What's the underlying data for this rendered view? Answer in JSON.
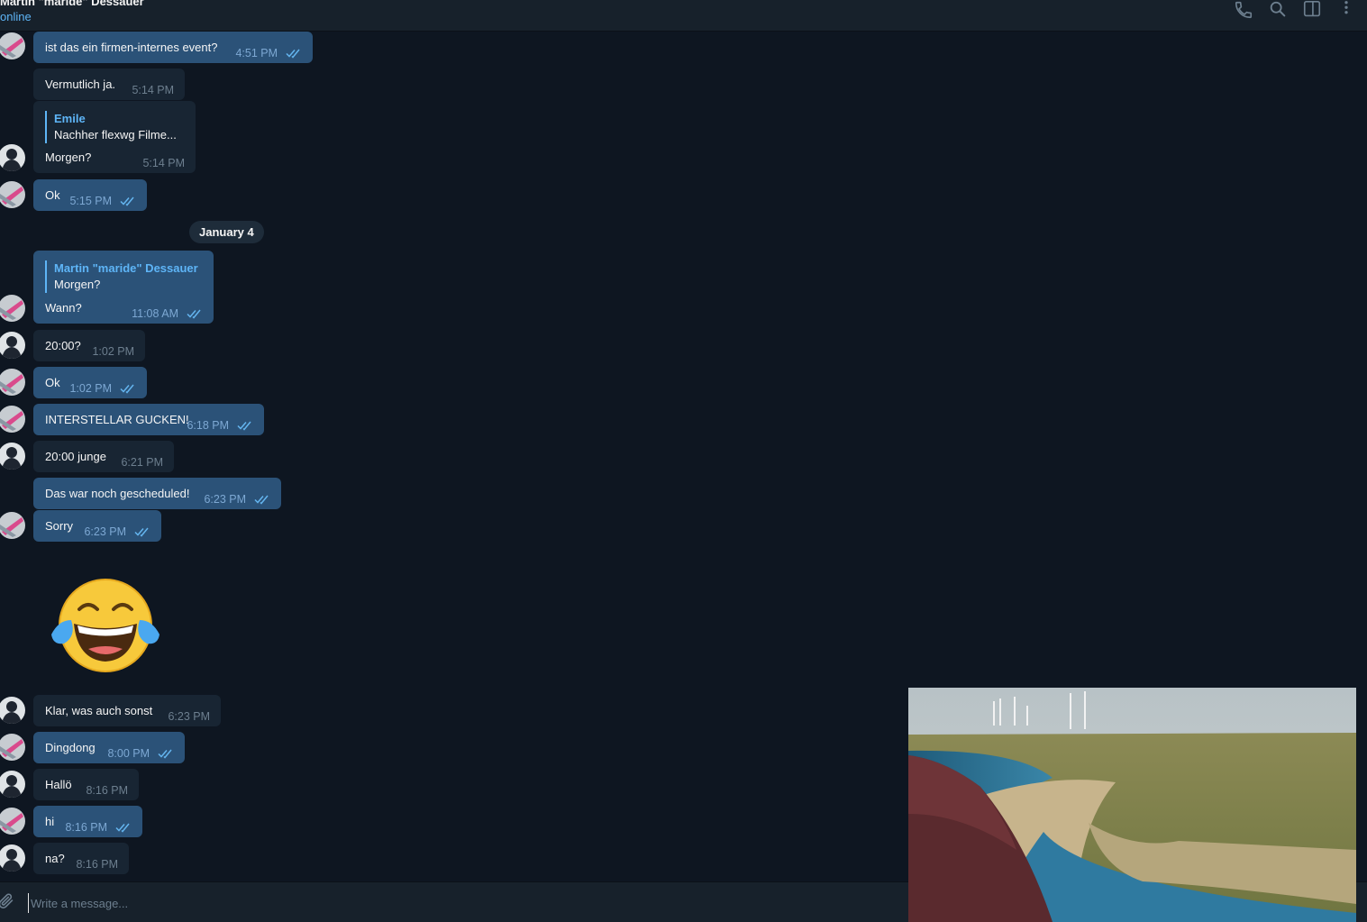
{
  "header": {
    "title": "Martin \"maride\" Dessauer",
    "status": "online",
    "icons": [
      "phone-icon",
      "search-icon",
      "sidebar-toggle-icon",
      "more-options-icon"
    ]
  },
  "messages": [
    {
      "dir": "out",
      "text": "ist das ein firmen-internes event?",
      "time": "4:51 PM",
      "read": true,
      "avatar": "martin"
    },
    {
      "dir": "in",
      "text": "Vermutlich ja.",
      "time": "5:14 PM",
      "avatar": null
    },
    {
      "dir": "in",
      "reply_name": "Emile",
      "reply_text": "Nachher flexwg Filme...",
      "text": "Morgen?",
      "time": "5:14 PM",
      "avatar": "emile"
    },
    {
      "dir": "out",
      "text": "Ok",
      "time": "5:15 PM",
      "read": true,
      "avatar": "martin"
    },
    {
      "dir": "out",
      "reply_name": "Martin \"maride\" Dessauer",
      "reply_text": "Morgen?",
      "text": "Wann?",
      "time": "11:08 AM",
      "read": true,
      "avatar": "martin"
    },
    {
      "dir": "in",
      "text": "20:00?",
      "time": "1:02 PM",
      "avatar": "emile"
    },
    {
      "dir": "out",
      "text": "Ok",
      "time": "1:02 PM",
      "read": true,
      "avatar": "martin"
    },
    {
      "dir": "out",
      "text": "INTERSTELLAR GUCKEN!",
      "time": "6:18 PM",
      "read": true,
      "avatar": "martin"
    },
    {
      "dir": "in",
      "text": "20:00 junge",
      "time": "6:21 PM",
      "avatar": "emile"
    },
    {
      "dir": "out",
      "text": "Das war noch gescheduled!",
      "time": "6:23 PM",
      "read": true,
      "avatar": null
    },
    {
      "dir": "out",
      "text": "Sorry",
      "time": "6:23 PM",
      "read": true,
      "avatar": "martin"
    },
    {
      "dir": "in",
      "text": "Klar, was auch sonst",
      "time": "6:23 PM",
      "avatar": "emile"
    },
    {
      "dir": "out",
      "text": "Dingdong",
      "time": "8:00 PM",
      "read": true,
      "avatar": "martin"
    },
    {
      "dir": "in",
      "text": "Hallö",
      "time": "8:16 PM",
      "avatar": "emile"
    },
    {
      "dir": "out",
      "text": "hi",
      "time": "8:16 PM",
      "read": true,
      "avatar": "martin"
    },
    {
      "dir": "in",
      "text": "na?",
      "time": "8:16 PM",
      "avatar": "emile"
    }
  ],
  "date_separator": "January 4",
  "sticker": "laughing-tears-emoji",
  "composer": {
    "placeholder": "Write a message..."
  },
  "video_overlay": {
    "description_icon": "video-player"
  },
  "colors": {
    "background": "#0e1621",
    "header": "#17212b",
    "incoming_bubble": "#182533",
    "outgoing_bubble": "#2b5278",
    "accent": "#5eb5f7"
  }
}
